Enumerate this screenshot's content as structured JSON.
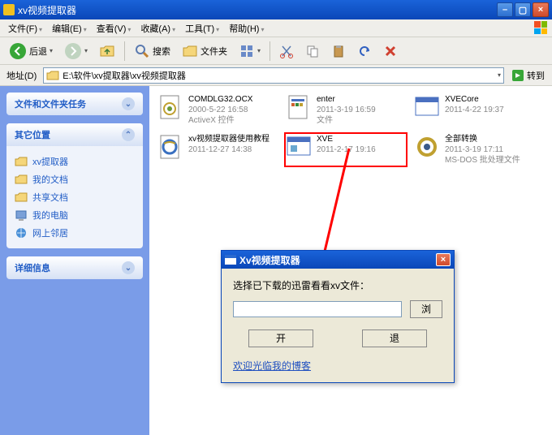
{
  "titlebar": {
    "title": "xv视频提取器"
  },
  "menu": {
    "file": "文件(F)",
    "edit": "编辑(E)",
    "view": "查看(V)",
    "fav": "收藏(A)",
    "tools": "工具(T)",
    "help": "帮助(H)"
  },
  "toolbar": {
    "back": "后退",
    "search": "搜索",
    "folders": "文件夹"
  },
  "address": {
    "label": "地址(D)",
    "path": "E:\\软件\\xv提取器\\xv视频提取器",
    "go": "转到"
  },
  "sidebar": {
    "box1": {
      "title": "文件和文件夹任务"
    },
    "box2": {
      "title": "其它位置",
      "items": [
        "xv提取器",
        "我的文档",
        "共享文档",
        "我的电脑",
        "网上邻居"
      ]
    },
    "box3": {
      "title": "详细信息"
    }
  },
  "files": [
    {
      "name": "COMDLG32.OCX",
      "meta": "2000-5-22 16:58",
      "type": "ActiveX 控件",
      "icon": "ocx"
    },
    {
      "name": "enter",
      "meta": "2011-3-19 16:59",
      "type": "文件",
      "icon": "doc"
    },
    {
      "name": "XVECore",
      "meta": "2011-4-22 19:37",
      "type": "",
      "icon": "app"
    },
    {
      "name": "xv视频提取器使用教程",
      "meta": "2011-12-27 14:38",
      "type": "",
      "icon": "ie"
    },
    {
      "name": "XVE",
      "meta": "2011-2-17 19:16",
      "type": "",
      "icon": "app2",
      "highlight": true
    },
    {
      "name": "全部转换",
      "meta": "2011-3-19 17:11",
      "type": "MS-DOS 批处理文件",
      "icon": "bat"
    }
  ],
  "dialog": {
    "title": "Xv视频提取器",
    "label": "选择已下载的迅雷看看xv文件：",
    "browse": "浏",
    "open": "开",
    "close": "退",
    "link": "欢迎光临我的博客"
  }
}
